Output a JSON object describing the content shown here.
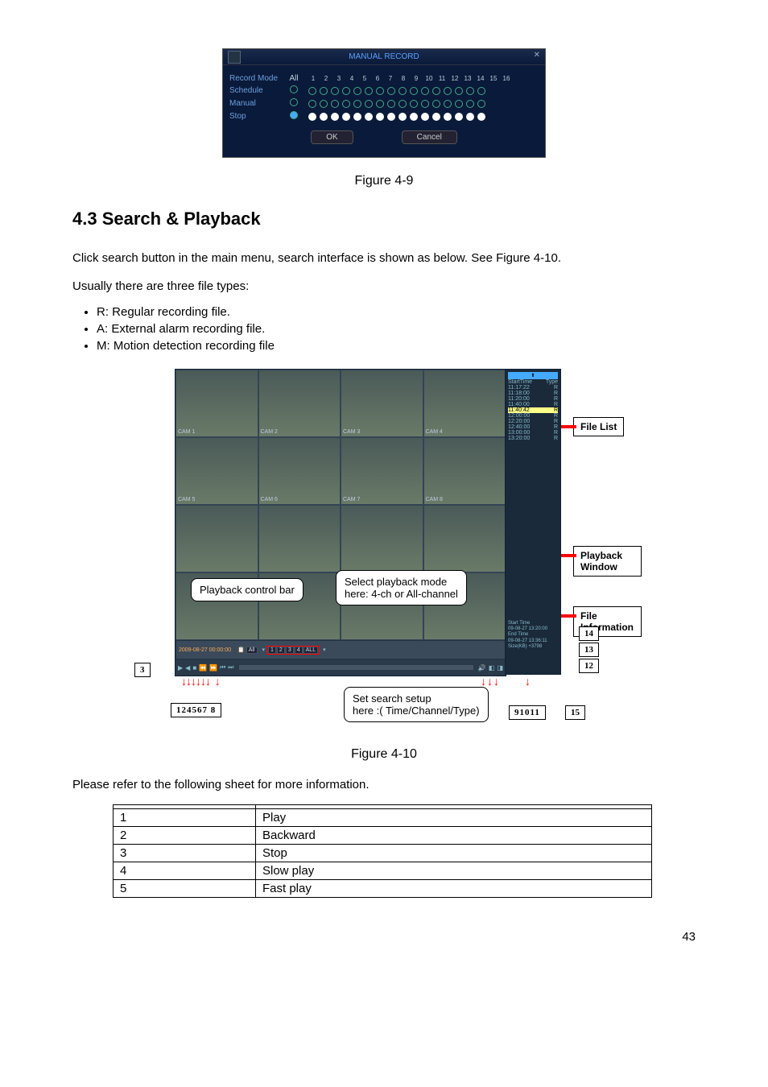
{
  "manual_record": {
    "title": "MANUAL RECORD",
    "rows": {
      "header": "Record Mode",
      "all": "All",
      "schedule": "Schedule",
      "manual": "Manual",
      "stop": "Stop"
    },
    "channels": [
      "1",
      "2",
      "3",
      "4",
      "5",
      "6",
      "7",
      "8",
      "9",
      "10",
      "11",
      "12",
      "13",
      "14",
      "15",
      "16"
    ],
    "ok": "OK",
    "cancel": "Cancel"
  },
  "fig9": "Figure 4-9",
  "section_title": "4.3   Search & Playback",
  "para1": "Click search button in the main menu, search interface is shown as below. See Figure 4-10.",
  "para2": "Usually there are three file types:",
  "bullets": [
    "R: Regular recording file.",
    "A: External alarm recording file.",
    "M: Motion detection recording file"
  ],
  "playback": {
    "file_list_label": "File List",
    "playback_window_label": "Playback Window",
    "file_info_label": "File Information",
    "callout_control": "Playback control bar",
    "callout_mode_l1": "Select playback mode",
    "callout_mode_l2": "here: 4-ch or All-channel",
    "callout_search_l1": "Set search setup",
    "callout_search_l2": "here :( Time/Channel/Type)",
    "nums_left": "124567  8",
    "nums_mid": "91011",
    "num3": "3",
    "num12": "12",
    "num13": "13",
    "num14": "14",
    "num15": "15",
    "sidebar_header_l": "StartTime",
    "sidebar_header_r": "Type",
    "files": [
      {
        "t": "11:17:22",
        "y": "R"
      },
      {
        "t": "11:18:00",
        "y": "R"
      },
      {
        "t": "11:20:00",
        "y": "R"
      },
      {
        "t": "11:40:00",
        "y": "R"
      },
      {
        "t": "11:40:42",
        "y": "R"
      },
      {
        "t": "12:00:00",
        "y": "R"
      },
      {
        "t": "12:20:00",
        "y": "R"
      },
      {
        "t": "12:40:00",
        "y": "R"
      },
      {
        "t": "13:00:00",
        "y": "R"
      },
      {
        "t": "13:20:00",
        "y": "R"
      }
    ],
    "info_start_l": "Start Time",
    "info_start_v": "09-08-27 13:20:00",
    "info_end_l": "End Time",
    "info_end_v": "09-08-27 13:36:11",
    "info_size": "Size(KB)  +3798",
    "cam_labels": [
      "CAM 1",
      "CAM 2",
      "CAM 3",
      "CAM 4",
      "CAM 5",
      "CAM 6",
      "CAM 7",
      "CAM 8"
    ],
    "searchbar_time": "2009-08-27 00:00:00",
    "searchbar_all": "All",
    "searchbar_ch": [
      "1",
      "2",
      "3",
      "4",
      "ALL"
    ]
  },
  "fig10": "Figure 4-10",
  "sheet_intro": "Please refer to the following sheet for more information.",
  "table": [
    {
      "n": "1",
      "v": "Play"
    },
    {
      "n": "2",
      "v": "Backward"
    },
    {
      "n": "3",
      "v": "Stop"
    },
    {
      "n": "4",
      "v": "Slow play"
    },
    {
      "n": "5",
      "v": "Fast play"
    }
  ],
  "page": "43"
}
